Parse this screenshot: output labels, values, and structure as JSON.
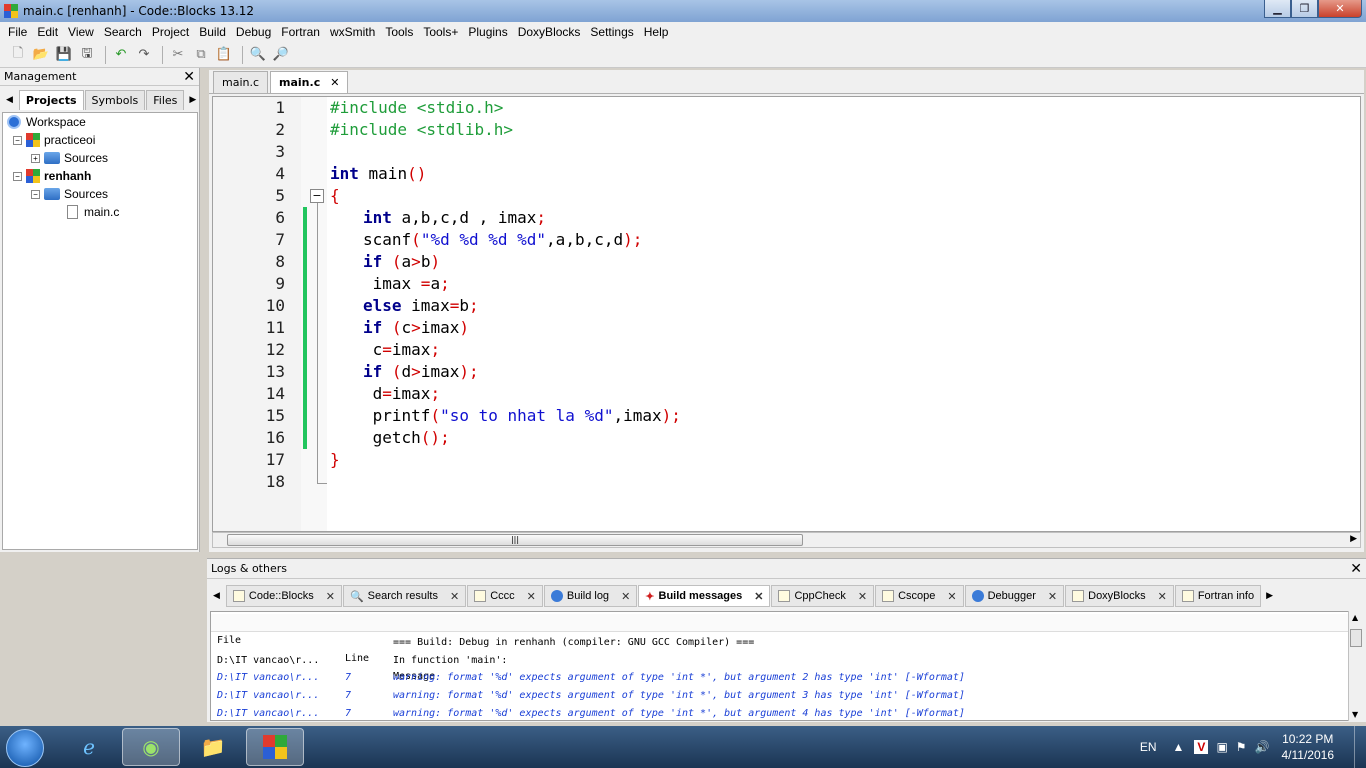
{
  "window": {
    "title": "main.c [renhanh] - Code::Blocks 13.12"
  },
  "menu": [
    "File",
    "Edit",
    "View",
    "Search",
    "Project",
    "Build",
    "Debug",
    "Fortran",
    "wxSmith",
    "Tools",
    "Tools+",
    "Plugins",
    "DoxyBlocks",
    "Settings",
    "Help"
  ],
  "management": {
    "title": "Management",
    "tabs": [
      "Projects",
      "Symbols",
      "Files"
    ],
    "tree": {
      "workspace": "Workspace",
      "project1": "practiceoi",
      "sources1": "Sources",
      "project2": "renhanh",
      "sources2": "Sources",
      "file": "main.c"
    }
  },
  "editor": {
    "tabs": [
      "main.c",
      "main.c"
    ],
    "lines": [
      "1",
      "2",
      "3",
      "4",
      "5",
      "6",
      "7",
      "8",
      "9",
      "10",
      "11",
      "12",
      "13",
      "14",
      "15",
      "16",
      "17",
      "18"
    ],
    "code": {
      "l1a": "#include <stdio.h>",
      "l2a": "#include <stdlib.h>",
      "l4a": "int",
      "l4b": " main",
      "l4c": "()",
      "l5a": "{",
      "l6a": "int",
      "l6b": " a,b,c,d , imax",
      "l6c": ";",
      "l7a": "scanf",
      "l7b": "(",
      "l7c": "\"%d %d %d %d\"",
      "l7d": ",a,b,c,d",
      "l7e": ");",
      "l8a": "if",
      "l8b": " (",
      "l8c": "a",
      "l8d": ">",
      "l8e": "b",
      "l8f": ")",
      "l9a": " imax ",
      "l9b": "=",
      "l9c": "a",
      "l9d": ";",
      "l10a": "else",
      "l10b": " imax",
      "l10c": "=",
      "l10d": "b",
      "l10e": ";",
      "l11a": "if",
      "l11b": " (",
      "l11c": "c",
      "l11d": ">",
      "l11e": "imax",
      "l11f": ")",
      "l12a": " c",
      "l12b": "=",
      "l12c": "imax",
      "l12d": ";",
      "l13a": "if",
      "l13b": " (",
      "l13c": "d",
      "l13d": ">",
      "l13e": "imax",
      "l13f": ");",
      "l14a": " d",
      "l14b": "=",
      "l14c": "imax",
      "l14d": ";",
      "l15a": " printf",
      "l15b": "(",
      "l15c": "\"so to nhat la %d\"",
      "l15d": ",imax",
      "l15e": ");",
      "l16a": " getch",
      "l16b": "();",
      "l17a": "}"
    }
  },
  "logs": {
    "title": "Logs & others",
    "tabs": [
      "Code::Blocks",
      "Search results",
      "Cccc",
      "Build log",
      "Build messages",
      "CppCheck",
      "Cscope",
      "Debugger",
      "DoxyBlocks",
      "Fortran info"
    ],
    "headers": {
      "file": "File",
      "line": "Line",
      "message": "Message"
    },
    "rows": [
      {
        "file": "",
        "line": "",
        "message": "=== Build: Debug in renhanh (compiler: GNU GCC Compiler) ==="
      },
      {
        "file": "D:\\IT vancao\\r...",
        "line": "",
        "message": "In function 'main':"
      },
      {
        "file": "D:\\IT vancao\\r...",
        "line": "7",
        "message": "warning: format '%d' expects argument of type 'int *', but argument 2 has type 'int' [-Wformat]"
      },
      {
        "file": "D:\\IT vancao\\r...",
        "line": "7",
        "message": "warning: format '%d' expects argument of type 'int *', but argument 3 has type 'int' [-Wformat]"
      },
      {
        "file": "D:\\IT vancao\\r...",
        "line": "7",
        "message": "warning: format '%d' expects argument of type 'int *', but argument 4 has type 'int' [-Wformat]"
      }
    ]
  },
  "taskbar": {
    "lang": "EN",
    "time": "10:22 PM",
    "date": "4/11/2016"
  },
  "colors": {
    "preprocessor": "#1f9d3a",
    "keyword": "#00008b",
    "string": "#1010d0",
    "operator": "#d00000",
    "warning": "#1a3fd6",
    "changebar": "#22c55e"
  }
}
